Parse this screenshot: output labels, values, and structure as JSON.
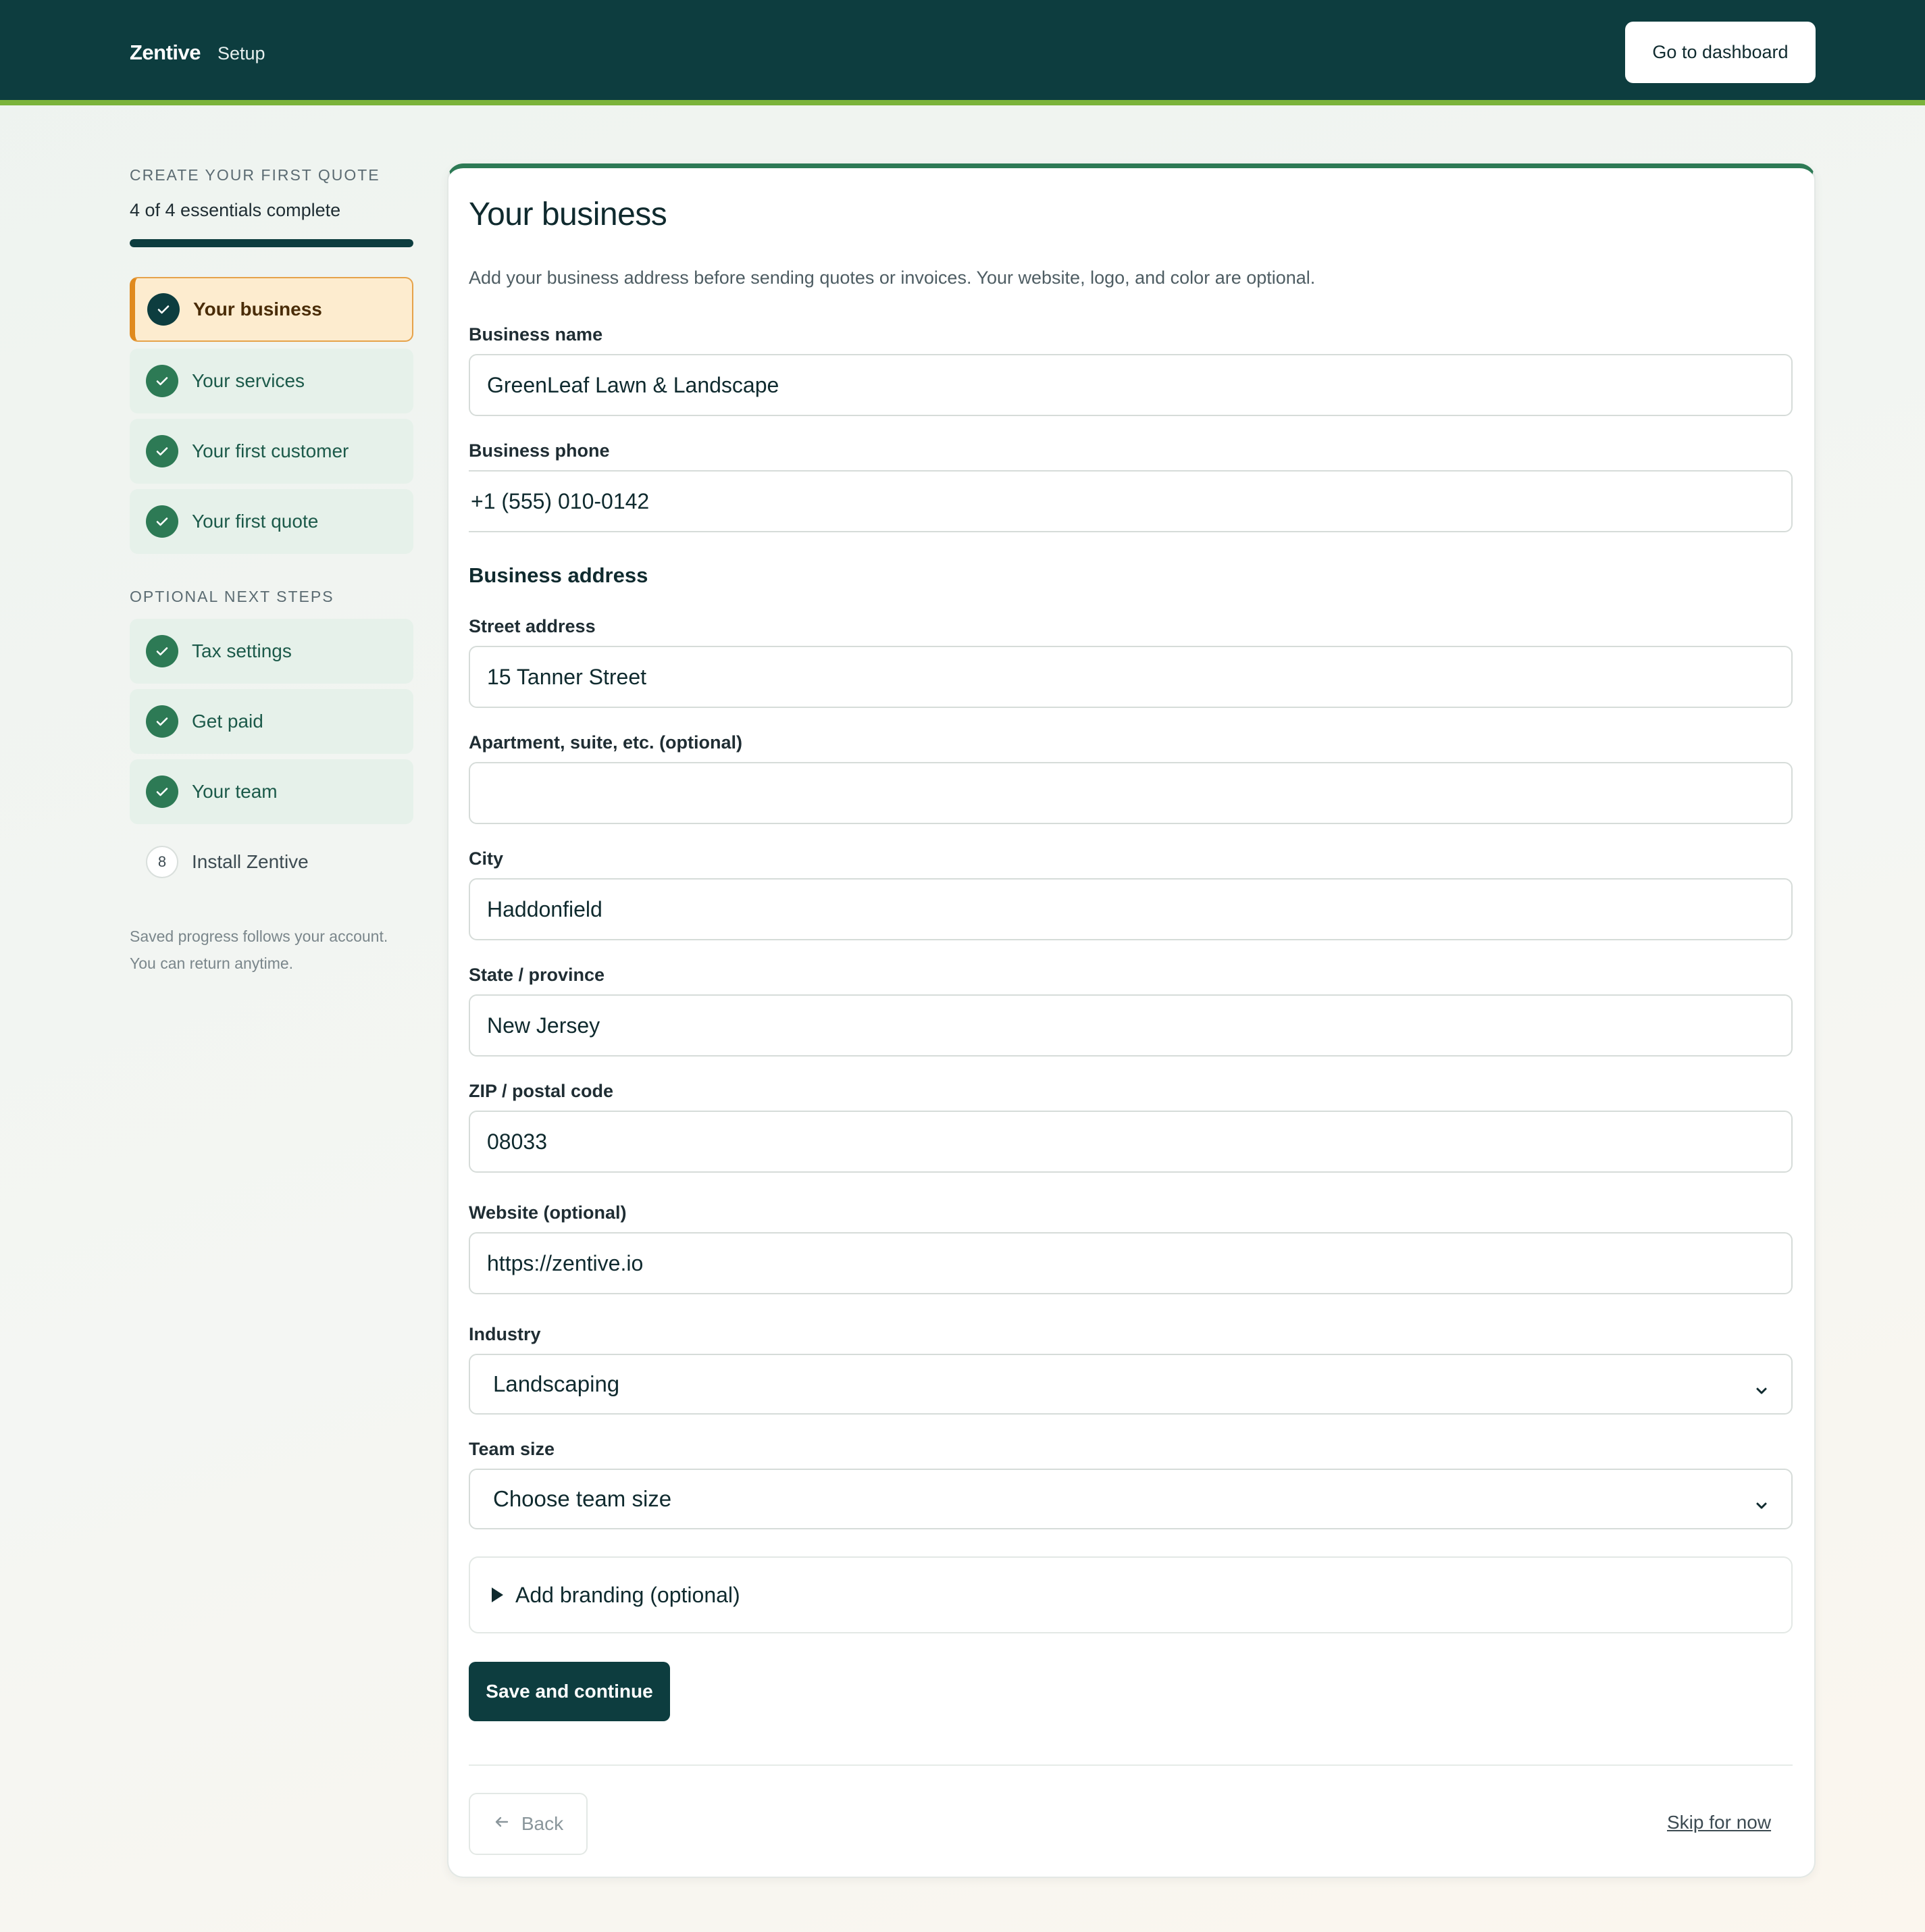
{
  "header": {
    "brand": "Zentive",
    "section": "Setup",
    "dashboard_button": "Go to dashboard"
  },
  "sidebar": {
    "eyebrow": "CREATE YOUR FIRST QUOTE",
    "progress_text": "4 of 4 essentials complete",
    "progress_fraction": 1.0,
    "essentials": [
      {
        "label": "Your business",
        "state": "active-done"
      },
      {
        "label": "Your services",
        "state": "done"
      },
      {
        "label": "Your first customer",
        "state": "done"
      },
      {
        "label": "Your first quote",
        "state": "done"
      }
    ],
    "optional_eyebrow": "OPTIONAL NEXT STEPS",
    "optional": [
      {
        "label": "Tax settings",
        "state": "done"
      },
      {
        "label": "Get paid",
        "state": "done"
      },
      {
        "label": "Your team",
        "state": "done"
      },
      {
        "label": "Install Zentive",
        "state": "todo",
        "number": "8"
      }
    ],
    "note_line1": "Saved progress follows your account.",
    "note_line2": "You can return anytime."
  },
  "form": {
    "title": "Your business",
    "description": "Add your business address before sending quotes or invoices. Your website, logo, and color are optional.",
    "business_name": {
      "label": "Business name",
      "value": "GreenLeaf Lawn & Landscape"
    },
    "business_phone": {
      "label": "Business phone",
      "value": "+1 (555) 010-0142"
    },
    "address_heading": "Business address",
    "street": {
      "label": "Street address",
      "value": "15 Tanner Street"
    },
    "apartment": {
      "label": "Apartment, suite, etc. (optional)",
      "value": ""
    },
    "city": {
      "label": "City",
      "value": "Haddonfield"
    },
    "state": {
      "label": "State / province",
      "value": "New Jersey"
    },
    "zip": {
      "label": "ZIP / postal code",
      "value": "08033"
    },
    "website": {
      "label": "Website (optional)",
      "value": "https://zentive.io"
    },
    "industry": {
      "label": "Industry",
      "value": "Landscaping"
    },
    "team_size": {
      "label": "Team size",
      "value": "Choose team size"
    },
    "branding_toggle": "Add branding (optional)",
    "save_button": "Save and continue",
    "back_button": "Back",
    "skip_link": "Skip for now"
  },
  "colors": {
    "header_bg": "#0d3d3f",
    "accent_green": "#2d7a55",
    "lime_stripe": "#7bb33b",
    "active_orange": "#e08a1e"
  }
}
